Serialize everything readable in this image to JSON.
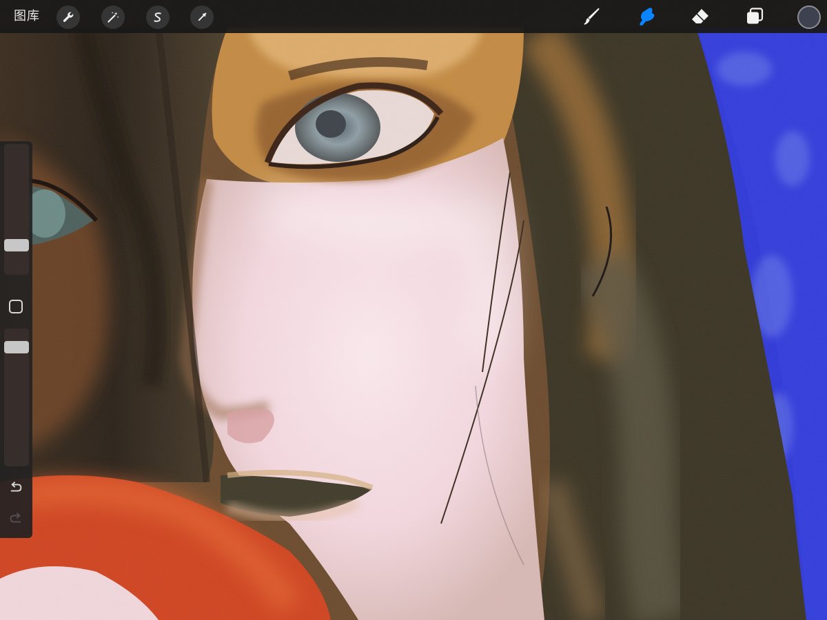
{
  "toolbar": {
    "gallery_label": "图库",
    "actions": [
      {
        "name": "actions-icon"
      },
      {
        "name": "adjustments-icon"
      },
      {
        "name": "selection-icon"
      },
      {
        "name": "transform-icon"
      }
    ],
    "tools": [
      {
        "name": "brush-icon",
        "active": false
      },
      {
        "name": "smudge-icon",
        "active": true
      },
      {
        "name": "eraser-icon",
        "active": false
      },
      {
        "name": "layers-icon",
        "active": false
      }
    ],
    "active_tool_color": "#0a84ff",
    "current_color": "#3e4150"
  },
  "sidebar": {
    "brush_size_level": 0.2,
    "opacity_level": 0.9,
    "modify_button": "square-icon",
    "undo": "undo-icon",
    "redo": "redo-icon",
    "redo_enabled": false
  },
  "canvas": {
    "background_color": "#2e38d8"
  }
}
